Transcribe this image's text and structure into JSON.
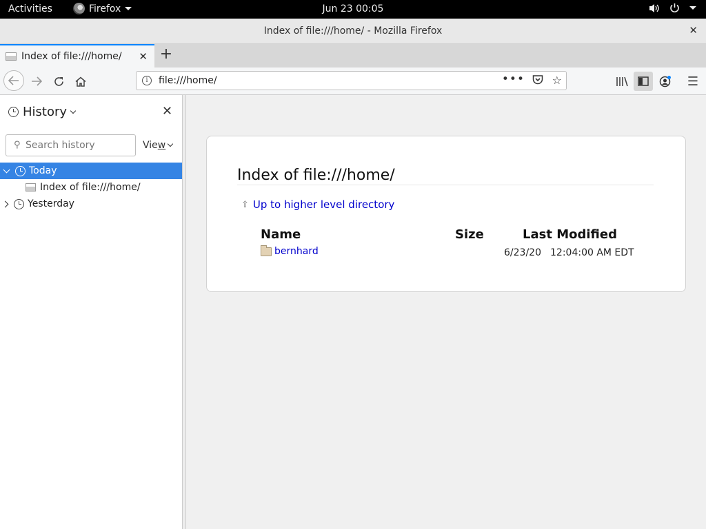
{
  "topbar": {
    "activities": "Activities",
    "app": "Firefox",
    "clock": "Jun 23  00:05"
  },
  "window": {
    "title": "Index of file:///home/ - Mozilla Firefox"
  },
  "tab": {
    "label": "Index of file:///home/"
  },
  "urlbar": {
    "url": "file:///home/",
    "dots": "•••"
  },
  "sidebar": {
    "title": "History",
    "search_placeholder": "Search history",
    "view_label": "View",
    "view_underlined": "w",
    "tree": {
      "today": "Today",
      "entry": "Index of file:///home/",
      "yesterday": "Yesterday"
    }
  },
  "page": {
    "heading": "Index of file:///home/",
    "up_link": "Up to higher level directory",
    "columns": {
      "name": "Name",
      "size": "Size",
      "modified": "Last Modified"
    },
    "rows": [
      {
        "name": "bernhard",
        "size": "",
        "date": "6/23/20",
        "time": "12:04:00 AM EDT"
      }
    ]
  },
  "colors": {
    "accent": "#0a84ff",
    "selection": "#3584e4",
    "link": "#0000cc"
  }
}
